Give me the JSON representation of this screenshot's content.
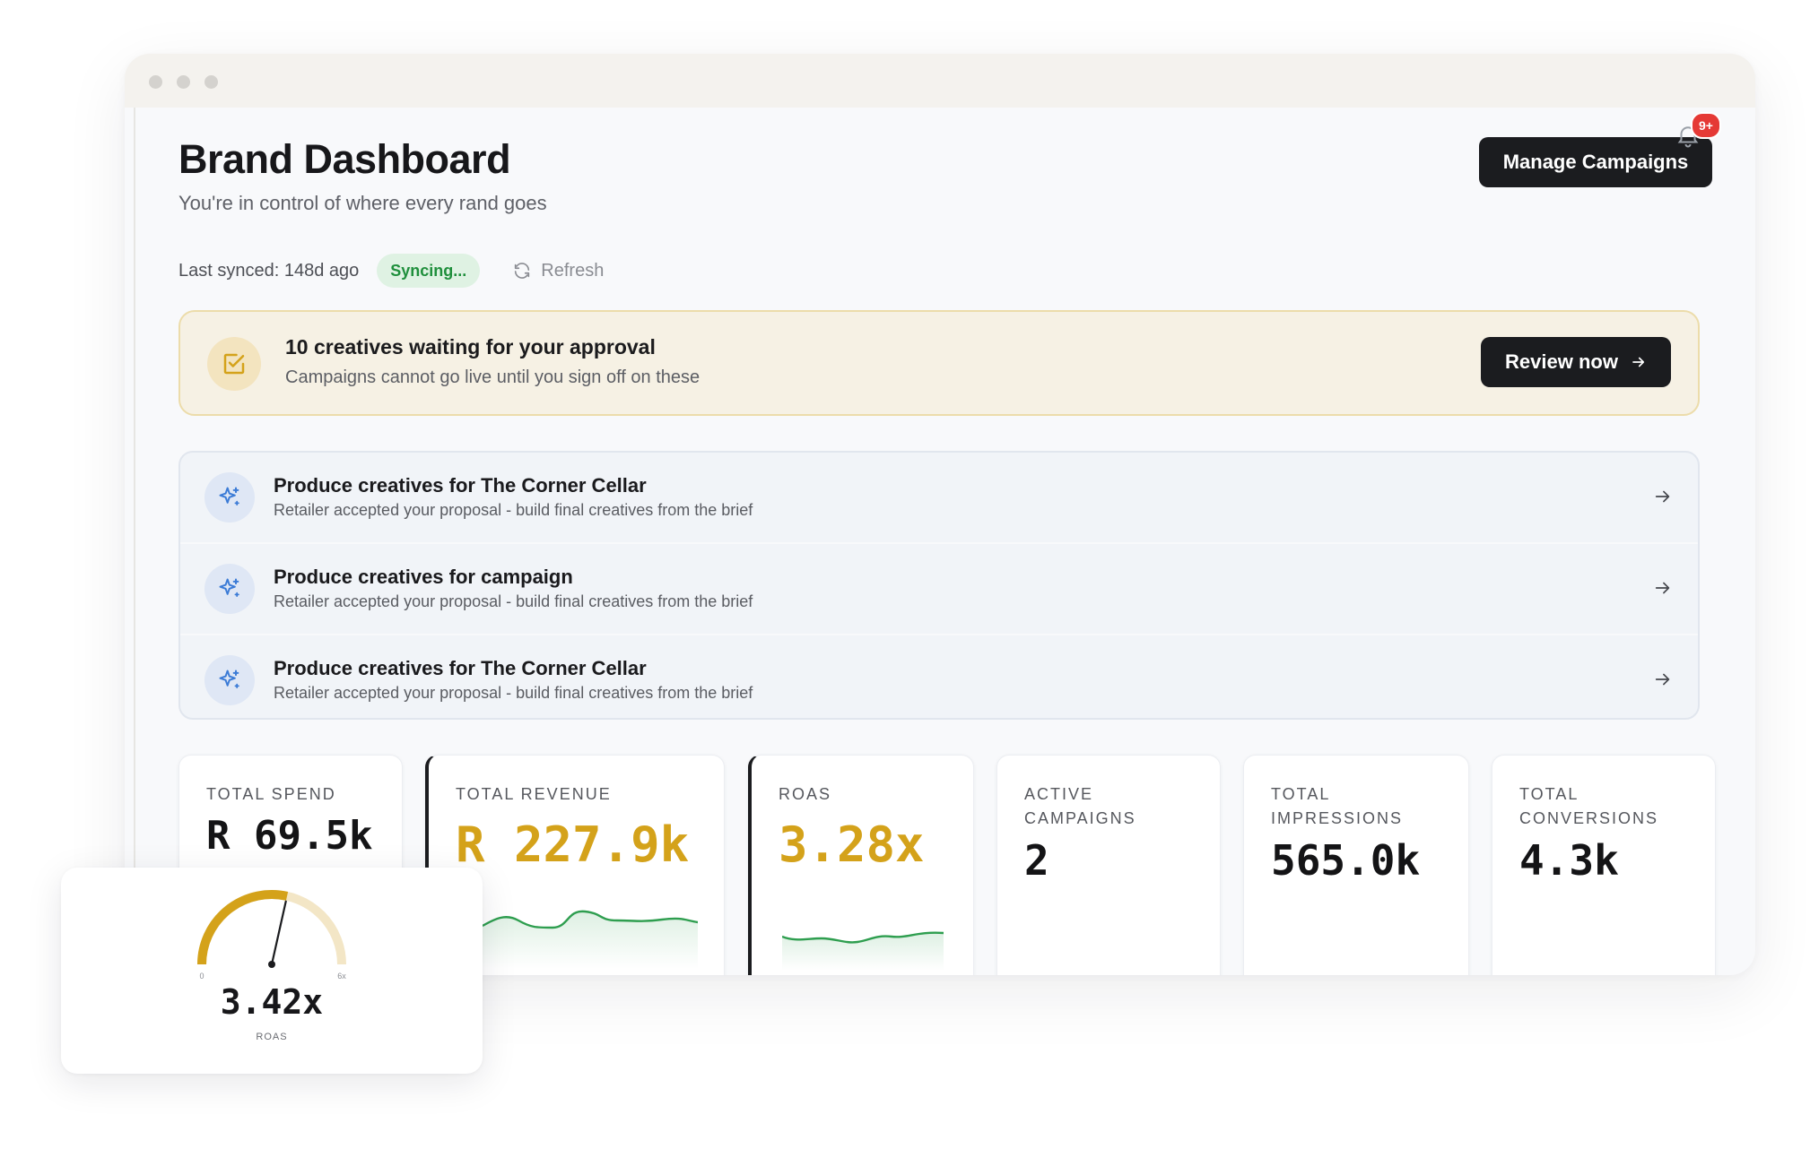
{
  "header": {
    "title": "Brand Dashboard",
    "subtitle": "You're in control of where every rand goes",
    "manage_button": "Manage Campaigns",
    "notification_badge": "9+"
  },
  "sync": {
    "last_synced": "Last synced: 148d ago",
    "status": "Syncing...",
    "refresh_label": "Refresh"
  },
  "approval_banner": {
    "title": "10 creatives waiting for your approval",
    "subtitle": "Campaigns cannot go live until you sign off on these",
    "button_label": "Review now",
    "accent_color": "#d4a21a"
  },
  "tasks": [
    {
      "title": "Produce creatives for The Corner Cellar",
      "subtitle": "Retailer accepted your proposal - build final creatives from the brief"
    },
    {
      "title": "Produce creatives for campaign",
      "subtitle": "Retailer accepted your proposal - build final creatives from the brief"
    },
    {
      "title": "Produce creatives for The Corner Cellar",
      "subtitle": "Retailer accepted your proposal - build final creatives from the brief"
    }
  ],
  "metrics": [
    {
      "label": "TOTAL SPEND",
      "value": "R 69.5k"
    },
    {
      "label": "TOTAL REVENUE",
      "value": "R 227.9k"
    },
    {
      "label": "ROAS",
      "value": "3.28x"
    },
    {
      "label": "ACTIVE CAMPAIGNS",
      "value": "2"
    },
    {
      "label": "TOTAL IMPRESSIONS",
      "value": "565.0k"
    },
    {
      "label": "TOTAL CONVERSIONS",
      "value": "4.3k"
    }
  ],
  "gauge": {
    "value_text": "3.42x",
    "label": "ROAS",
    "min_label": "0",
    "max_label": "6x",
    "value": 3.42,
    "min": 0,
    "max": 6,
    "fill_color": "#d4a21a",
    "track_color": "#f3e6c6"
  },
  "colors": {
    "gold": "#d4a21a",
    "dark": "#1b1c1f",
    "success": "#1f8f3c",
    "alert": "#e53935",
    "sparkline": "#2e9e4f"
  },
  "icons": {
    "approval": "checkbox-edit-icon",
    "task": "sparkles-icon",
    "bell": "bell-icon",
    "refresh": "refresh-icon",
    "arrow": "arrow-right-icon"
  }
}
